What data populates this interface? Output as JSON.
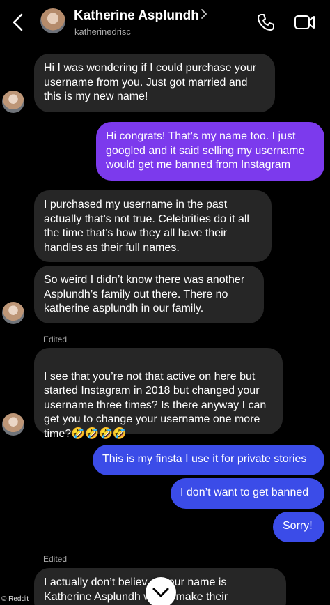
{
  "header": {
    "contact_name": "Katherine Asplundh",
    "contact_username": "katherinedrisc",
    "icons": [
      "back-icon",
      "call-icon",
      "video-call-icon"
    ]
  },
  "messages": [
    {
      "from": "them",
      "text": "Hi I was wondering if I could purchase your\nusername from you. Just got married and\nthis is my new name!"
    },
    {
      "from": "me",
      "text": "Hi congrats! That’s my name too. I just\ngoogled and it said selling my username\nwould get me banned from Instagram"
    },
    {
      "from": "them",
      "text": "I purchased my username in the past\nactually that’s not true. Celebrities do it all\nthe time that’s how they all have their\nhandles as their full names."
    },
    {
      "from": "them",
      "text": "So weird I didn’t know there was another\nAsplundh’s family out there. There no\nkatherine asplundh in our family."
    },
    {
      "from": "them",
      "text": "I see that you’re not that active on here but\nstarted Instagram in 2018 but changed your\nusername three times? Is there anyway I can\nget you to change your username one more\ntime?",
      "emojis": "🤣🤣🤣🤣"
    },
    {
      "from": "me",
      "text": "This is my finsta I use it for private stories"
    },
    {
      "from": "me",
      "text": "I don’t want to get banned"
    },
    {
      "from": "me",
      "text": "Sorry!"
    },
    {
      "from": "them",
      "text": "I actually don’t believ    at your name is\nKatherine Asplundh     would make their"
    }
  ],
  "edited_label_1": "Edited",
  "edited_label_2": "Edited",
  "watermark": "© Reddit",
  "colors": {
    "background": "#000000",
    "received_bubble": "#262626",
    "sent_bubble_purple": "#7c3aed",
    "sent_bubble_blue": "#3b4ce8"
  }
}
